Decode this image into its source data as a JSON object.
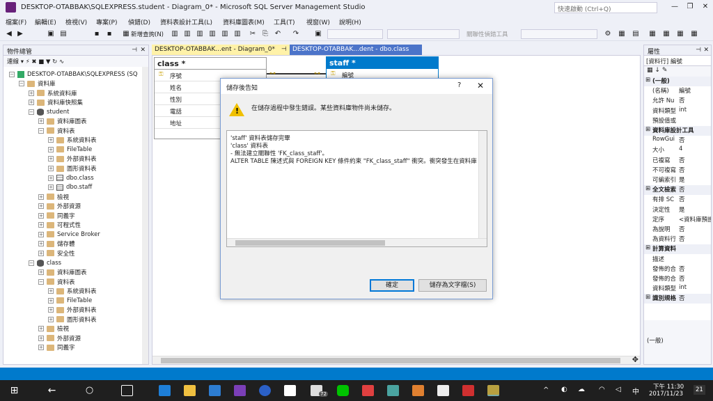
{
  "window": {
    "title": "DESKTOP-OTABBAK\\SQLEXPRESS.student - Diagram_0* - Microsoft SQL Server Management Studio",
    "quick_launch_placeholder": "快速啟動 (Ctrl+Q)"
  },
  "menu": [
    "檔案(F)",
    "編輯(E)",
    "檢視(V)",
    "專案(P)",
    "偵錯(D)",
    "資料表設計工具(L)",
    "資料庫圖表(M)",
    "工具(T)",
    "視窗(W)",
    "說明(H)"
  ],
  "toolbar": {
    "new_query": "新增查詢(N)",
    "relationship_tools": "關聯性偵錯工具"
  },
  "object_explorer": {
    "title": "物件總管",
    "connect_label": "連線",
    "items": [
      {
        "label": "DESKTOP-OTABBAK\\SQLEXPRESS (SQ",
        "indent": 0,
        "icon": "server",
        "exp": "−"
      },
      {
        "label": "資料庫",
        "indent": 1,
        "icon": "folder",
        "exp": "−"
      },
      {
        "label": "系統資料庫",
        "indent": 2,
        "icon": "folder",
        "exp": "+"
      },
      {
        "label": "資料庫快照集",
        "indent": 2,
        "icon": "folder",
        "exp": "+"
      },
      {
        "label": "student",
        "indent": 2,
        "icon": "db",
        "exp": "−"
      },
      {
        "label": "資料庫圖表",
        "indent": 3,
        "icon": "folder",
        "exp": "+"
      },
      {
        "label": "資料表",
        "indent": 3,
        "icon": "folder",
        "exp": "−"
      },
      {
        "label": "系統資料表",
        "indent": 4,
        "icon": "folder",
        "exp": "+"
      },
      {
        "label": "FileTable",
        "indent": 4,
        "icon": "folder",
        "exp": "+"
      },
      {
        "label": "外部資料表",
        "indent": 4,
        "icon": "folder",
        "exp": "+"
      },
      {
        "label": "圖形資料表",
        "indent": 4,
        "icon": "folder",
        "exp": "+"
      },
      {
        "label": "dbo.class",
        "indent": 4,
        "icon": "table",
        "exp": "+"
      },
      {
        "label": "dbo.staff",
        "indent": 4,
        "icon": "table",
        "exp": "+"
      },
      {
        "label": "檢視",
        "indent": 3,
        "icon": "folder",
        "exp": "+"
      },
      {
        "label": "外部資源",
        "indent": 3,
        "icon": "folder",
        "exp": "+"
      },
      {
        "label": "同義字",
        "indent": 3,
        "icon": "folder",
        "exp": "+"
      },
      {
        "label": "可程式性",
        "indent": 3,
        "icon": "folder",
        "exp": "+"
      },
      {
        "label": "Service Broker",
        "indent": 3,
        "icon": "folder",
        "exp": "+"
      },
      {
        "label": "儲存體",
        "indent": 3,
        "icon": "folder",
        "exp": "+"
      },
      {
        "label": "安全性",
        "indent": 3,
        "icon": "folder",
        "exp": "+"
      },
      {
        "label": "class",
        "indent": 2,
        "icon": "db",
        "exp": "−"
      },
      {
        "label": "資料庫圖表",
        "indent": 3,
        "icon": "folder",
        "exp": "+"
      },
      {
        "label": "資料表",
        "indent": 3,
        "icon": "folder",
        "exp": "−"
      },
      {
        "label": "系統資料表",
        "indent": 4,
        "icon": "folder",
        "exp": "+"
      },
      {
        "label": "FileTable",
        "indent": 4,
        "icon": "folder",
        "exp": "+"
      },
      {
        "label": "外部資料表",
        "indent": 4,
        "icon": "folder",
        "exp": "+"
      },
      {
        "label": "圖形資料表",
        "indent": 4,
        "icon": "folder",
        "exp": "+"
      },
      {
        "label": "檢視",
        "indent": 3,
        "icon": "folder",
        "exp": "+"
      },
      {
        "label": "外部資源",
        "indent": 3,
        "icon": "folder",
        "exp": "+"
      },
      {
        "label": "同義字",
        "indent": 3,
        "icon": "folder",
        "exp": "+"
      }
    ]
  },
  "tabs": [
    {
      "label": "DESKTOP-OTABBAK...ent - Diagram_0*",
      "active": true
    },
    {
      "label": "DESKTOP-OTABBAK...dent - dbo.class",
      "active": false
    }
  ],
  "diagram": {
    "class_table": {
      "title": "class *",
      "columns": [
        "序號",
        "姓名",
        "性別",
        "電話",
        "地址"
      ]
    },
    "staff_table": {
      "title": "staff *",
      "columns": [
        "編號"
      ]
    }
  },
  "properties": {
    "title": "屬性",
    "object": "[資料行] 編號",
    "rows": [
      {
        "name": "(一般)",
        "value": "",
        "section": true
      },
      {
        "name": "(名稱)",
        "value": "編號"
      },
      {
        "name": "允許 Nu",
        "value": "否"
      },
      {
        "name": "資料類型",
        "value": "int"
      },
      {
        "name": "預設值或",
        "value": ""
      },
      {
        "name": "資料庫設計工具",
        "value": "",
        "section": true
      },
      {
        "name": "RowGui",
        "value": "否"
      },
      {
        "name": "大小",
        "value": "4"
      },
      {
        "name": "已複寫",
        "value": "否"
      },
      {
        "name": "不可複寫",
        "value": "否"
      },
      {
        "name": "可編索引",
        "value": "是"
      },
      {
        "name": "全文檢索",
        "value": "否",
        "section": true
      },
      {
        "name": "有排 SC",
        "value": "否"
      },
      {
        "name": "決定性",
        "value": "是"
      },
      {
        "name": "定序",
        "value": "<資料庫預設"
      },
      {
        "name": "為說明",
        "value": "否"
      },
      {
        "name": "為資料行",
        "value": "否"
      },
      {
        "name": "計算資料",
        "value": "",
        "section": true
      },
      {
        "name": "描述",
        "value": ""
      },
      {
        "name": "發佈的合",
        "value": "否"
      },
      {
        "name": "發佈的合",
        "value": "否"
      },
      {
        "name": "資料類型",
        "value": "int"
      },
      {
        "name": "識別規格",
        "value": "否",
        "section": true
      }
    ],
    "footer": "(一般)"
  },
  "dialog": {
    "title": "儲存後告知",
    "help": "?",
    "close": "✕",
    "message": "在儲存過程中發生錯誤。某些資料庫物件尚未儲存。",
    "details": [
      "'staff' 資料表儲存完畢",
      "'class' 資料表",
      "- 無法建立關聯性 'FK_class_staff'。",
      "ALTER TABLE 陳述式與 FOREIGN KEY 條件約束 \"FK_class_staff\" 衝突。衝突發生在資料庫"
    ],
    "ok": "確定",
    "save_text": "儲存為文字檔(S)"
  },
  "taskbar": {
    "time": "下午 11:30",
    "date": "2017/11/23",
    "badge": "72",
    "notif": "21"
  },
  "colors": {
    "accent": "#007acc",
    "title_blue": "#007acc",
    "warning": "#f0c000"
  }
}
